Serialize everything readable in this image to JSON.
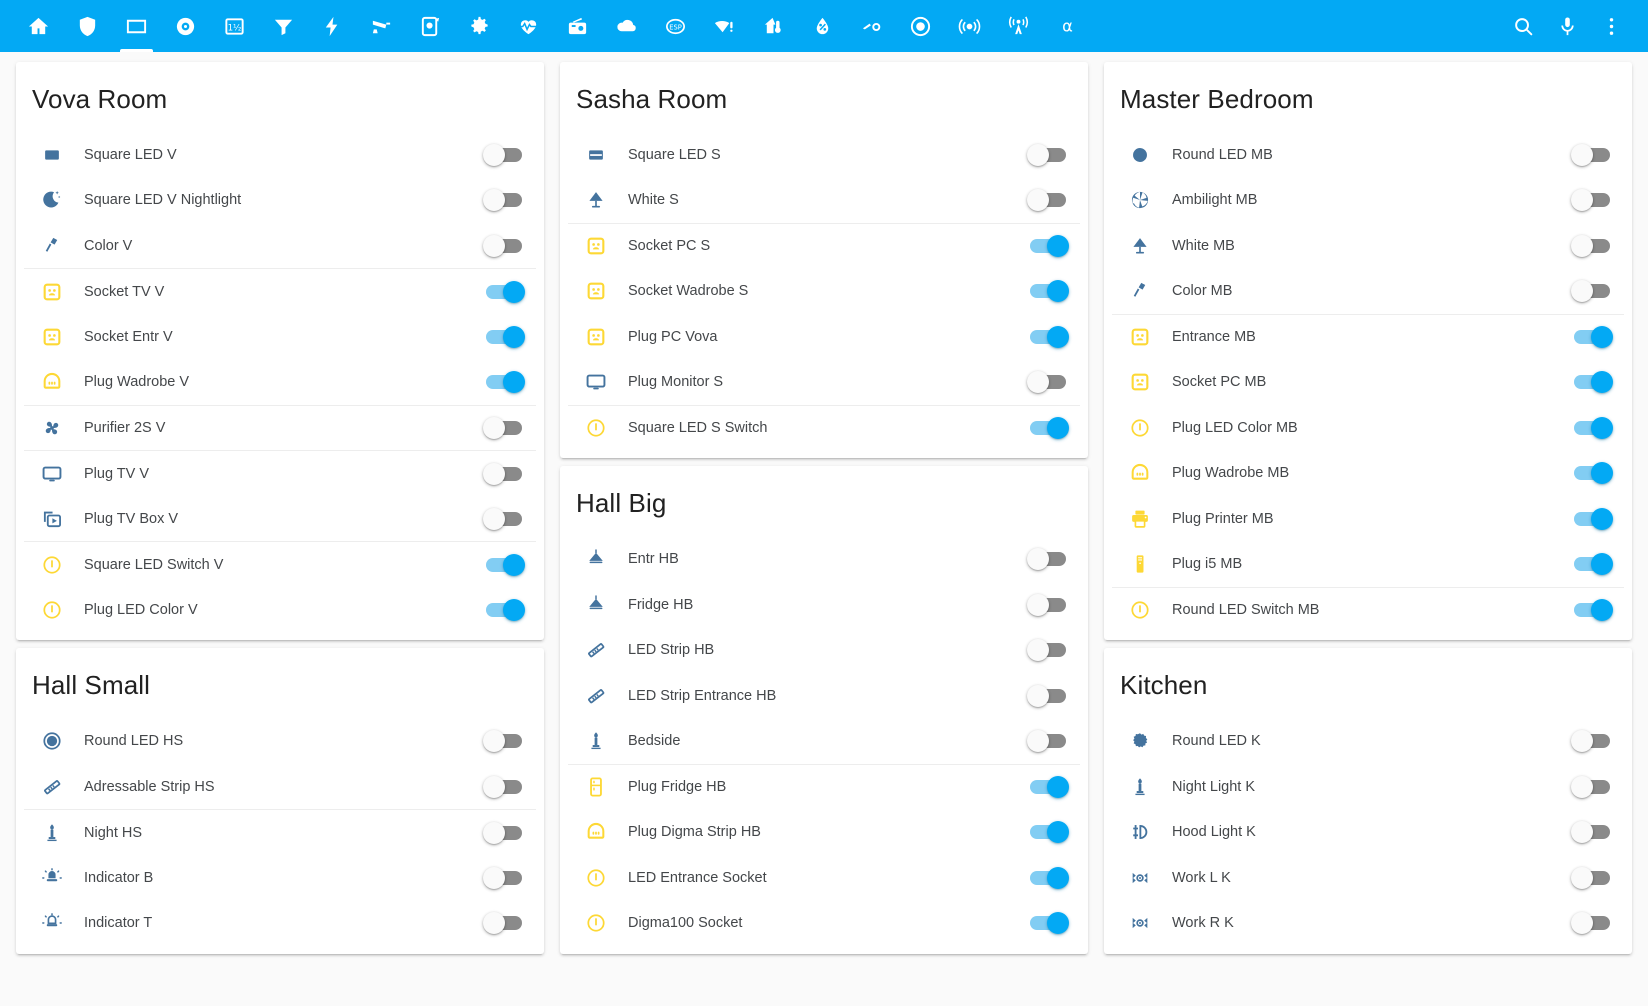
{
  "toolbar": {
    "background": "#03a9f4",
    "active_tab_index": 2,
    "tabs": [
      {
        "name": "home",
        "icon": "home-icon"
      },
      {
        "name": "shield",
        "icon": "shield-icon"
      },
      {
        "name": "lights",
        "icon": "square-outline-icon"
      },
      {
        "name": "vacuum",
        "icon": "disc-icon"
      },
      {
        "name": "counters",
        "icon": "numeric-box-icon"
      },
      {
        "name": "filter",
        "icon": "filter-icon"
      },
      {
        "name": "power",
        "icon": "lightning-bolt-icon"
      },
      {
        "name": "camera",
        "icon": "cctv-icon"
      },
      {
        "name": "scanner",
        "icon": "qr-scan-icon"
      },
      {
        "name": "settings",
        "icon": "gear-icon"
      },
      {
        "name": "health",
        "icon": "heart-pulse-icon"
      },
      {
        "name": "radio",
        "icon": "radio-icon"
      },
      {
        "name": "cloud",
        "icon": "cloud-icon"
      },
      {
        "name": "esp",
        "icon": "esp-badge-icon"
      },
      {
        "name": "wifi-alert",
        "icon": "wifi-alert-icon"
      },
      {
        "name": "thermostat",
        "icon": "home-thermometer-icon"
      },
      {
        "name": "humidity",
        "icon": "water-percent-icon"
      },
      {
        "name": "switches",
        "icon": "toggle-switch-icon"
      },
      {
        "name": "record",
        "icon": "record-circle-icon"
      },
      {
        "name": "broadcast",
        "icon": "access-point-icon"
      },
      {
        "name": "antenna",
        "icon": "antenna-icon"
      },
      {
        "name": "alpha",
        "icon": "alpha-icon"
      }
    ],
    "actions": [
      {
        "name": "search",
        "icon": "search-icon"
      },
      {
        "name": "assist",
        "icon": "microphone-icon"
      },
      {
        "name": "overflow",
        "icon": "dots-vertical-icon"
      }
    ]
  },
  "colors": {
    "accent": "#03a9f4",
    "toggle_on_track": "#82cdf3",
    "toggle_on_knob": "#03a9f4",
    "toggle_off_track": "#8a8a8a",
    "icon_blue": "#44739e",
    "icon_yellow": "#fdd835",
    "page_bg": "#fafafa",
    "card_bg": "#ffffff"
  },
  "columns": [
    {
      "cards": [
        {
          "title": "Vova Room",
          "rows": [
            {
              "label": "Square LED V",
              "icon": "led-square-icon",
              "color": "blue",
              "state": "off",
              "divider": false
            },
            {
              "label": "Square LED V Nightlight",
              "icon": "weather-night-icon",
              "color": "blue",
              "state": "off",
              "divider": false
            },
            {
              "label": "Color V",
              "icon": "desk-lamp-icon",
              "color": "blue",
              "state": "off",
              "divider": false
            },
            {
              "label": "Socket TV V",
              "icon": "power-socket-icon",
              "color": "yellow",
              "state": "on",
              "divider": true
            },
            {
              "label": "Socket Entr V",
              "icon": "power-socket-icon",
              "color": "yellow",
              "state": "on",
              "divider": false
            },
            {
              "label": "Plug Wadrobe V",
              "icon": "power-plug-strip-icon",
              "color": "yellow",
              "state": "on",
              "divider": false
            },
            {
              "label": "Purifier 2S V",
              "icon": "fan-icon",
              "color": "blue",
              "state": "off",
              "divider": true
            },
            {
              "label": "Plug TV V",
              "icon": "monitor-icon",
              "color": "blue",
              "state": "off",
              "divider": true
            },
            {
              "label": "Plug TV Box V",
              "icon": "tv-box-icon",
              "color": "blue",
              "state": "off",
              "divider": false
            },
            {
              "label": "Square LED Switch V",
              "icon": "power-circle-icon",
              "color": "yellow",
              "state": "on",
              "divider": true
            },
            {
              "label": "Plug LED Color V",
              "icon": "power-circle-icon",
              "color": "yellow",
              "state": "on",
              "divider": false
            }
          ]
        },
        {
          "title": "Hall Small",
          "rows": [
            {
              "label": "Round LED HS",
              "icon": "led-round-icon",
              "color": "blue",
              "state": "off",
              "divider": false
            },
            {
              "label": "Adressable Strip HS",
              "icon": "led-strip-icon",
              "color": "blue",
              "state": "off",
              "divider": false
            },
            {
              "label": "Night HS",
              "icon": "candle-icon",
              "color": "blue",
              "state": "off",
              "divider": true
            },
            {
              "label": "Indicator B",
              "icon": "alarm-light-icon",
              "color": "blue",
              "state": "off",
              "divider": false
            },
            {
              "label": "Indicator T",
              "icon": "alarm-light-off-icon",
              "color": "blue",
              "state": "off",
              "divider": false
            }
          ]
        }
      ]
    },
    {
      "cards": [
        {
          "title": "Sasha Room",
          "rows": [
            {
              "label": "Square LED S",
              "icon": "led-square-split-icon",
              "color": "blue",
              "state": "off",
              "divider": false
            },
            {
              "label": "White S",
              "icon": "lamp-icon",
              "color": "blue",
              "state": "off",
              "divider": false
            },
            {
              "label": "Socket PC S",
              "icon": "power-socket-icon",
              "color": "yellow",
              "state": "on",
              "divider": true
            },
            {
              "label": "Socket Wadrobe S",
              "icon": "power-socket-icon",
              "color": "yellow",
              "state": "on",
              "divider": false
            },
            {
              "label": "Plug PC Vova",
              "icon": "power-socket-icon",
              "color": "yellow",
              "state": "on",
              "divider": false
            },
            {
              "label": "Plug Monitor S",
              "icon": "monitor-icon",
              "color": "blue",
              "state": "off",
              "divider": false
            },
            {
              "label": "Square LED S Switch",
              "icon": "power-circle-icon",
              "color": "yellow",
              "state": "on",
              "divider": true
            }
          ]
        },
        {
          "title": "Hall Big",
          "rows": [
            {
              "label": "Entr HB",
              "icon": "ceiling-light-icon",
              "color": "blue",
              "state": "off",
              "divider": false
            },
            {
              "label": "Fridge HB",
              "icon": "ceiling-light-icon",
              "color": "blue",
              "state": "off",
              "divider": false
            },
            {
              "label": "LED Strip HB",
              "icon": "led-strip-icon",
              "color": "blue",
              "state": "off",
              "divider": false
            },
            {
              "label": "LED Strip Entrance HB",
              "icon": "led-strip-icon",
              "color": "blue",
              "state": "off",
              "divider": false
            },
            {
              "label": "Bedside",
              "icon": "candle-icon",
              "color": "blue",
              "state": "off",
              "divider": false
            },
            {
              "label": "Plug Fridge HB",
              "icon": "fridge-icon",
              "color": "yellow",
              "state": "on",
              "divider": true
            },
            {
              "label": "Plug Digma Strip HB",
              "icon": "power-plug-strip-icon",
              "color": "yellow",
              "state": "on",
              "divider": false
            },
            {
              "label": "LED Entrance Socket",
              "icon": "power-circle-icon",
              "color": "yellow",
              "state": "on",
              "divider": false
            },
            {
              "label": "Digma100 Socket",
              "icon": "power-circle-icon",
              "color": "yellow",
              "state": "on",
              "divider": false
            }
          ]
        }
      ]
    },
    {
      "cards": [
        {
          "title": "Master Bedroom",
          "rows": [
            {
              "label": "Round LED MB",
              "icon": "circle-filled-icon",
              "color": "blue",
              "state": "off",
              "divider": false
            },
            {
              "label": "Ambilight MB",
              "icon": "aperture-icon",
              "color": "blue",
              "state": "off",
              "divider": false
            },
            {
              "label": "White MB",
              "icon": "lamp-icon",
              "color": "blue",
              "state": "off",
              "divider": false
            },
            {
              "label": "Color MB",
              "icon": "desk-lamp-icon",
              "color": "blue",
              "state": "off",
              "divider": false
            },
            {
              "label": "Entrance MB",
              "icon": "power-socket-icon",
              "color": "yellow",
              "state": "on",
              "divider": true
            },
            {
              "label": "Socket PC MB",
              "icon": "power-socket-icon",
              "color": "yellow",
              "state": "on",
              "divider": false
            },
            {
              "label": "Plug LED Color MB",
              "icon": "power-circle-icon",
              "color": "yellow",
              "state": "on",
              "divider": false
            },
            {
              "label": "Plug Wadrobe MB",
              "icon": "power-plug-strip-icon",
              "color": "yellow",
              "state": "on",
              "divider": false
            },
            {
              "label": "Plug Printer MB",
              "icon": "printer-icon",
              "color": "yellow",
              "state": "on",
              "divider": false
            },
            {
              "label": "Plug i5 MB",
              "icon": "desktop-tower-icon",
              "color": "yellow",
              "state": "on",
              "divider": false
            },
            {
              "label": "Round LED Switch MB",
              "icon": "power-circle-icon",
              "color": "yellow",
              "state": "on",
              "divider": true
            }
          ]
        },
        {
          "title": "Kitchen",
          "rows": [
            {
              "label": "Round LED K",
              "icon": "led-flower-icon",
              "color": "blue",
              "state": "off",
              "divider": false
            },
            {
              "label": "Night Light K",
              "icon": "candle-icon",
              "color": "blue",
              "state": "off",
              "divider": false
            },
            {
              "label": "Hood Light K",
              "icon": "hood-light-icon",
              "color": "blue",
              "state": "off",
              "divider": false
            },
            {
              "label": "Work L K",
              "icon": "spotlight-icon",
              "color": "blue",
              "state": "off",
              "divider": false
            },
            {
              "label": "Work R K",
              "icon": "spotlight-icon",
              "color": "blue",
              "state": "off",
              "divider": false
            }
          ]
        }
      ]
    }
  ]
}
